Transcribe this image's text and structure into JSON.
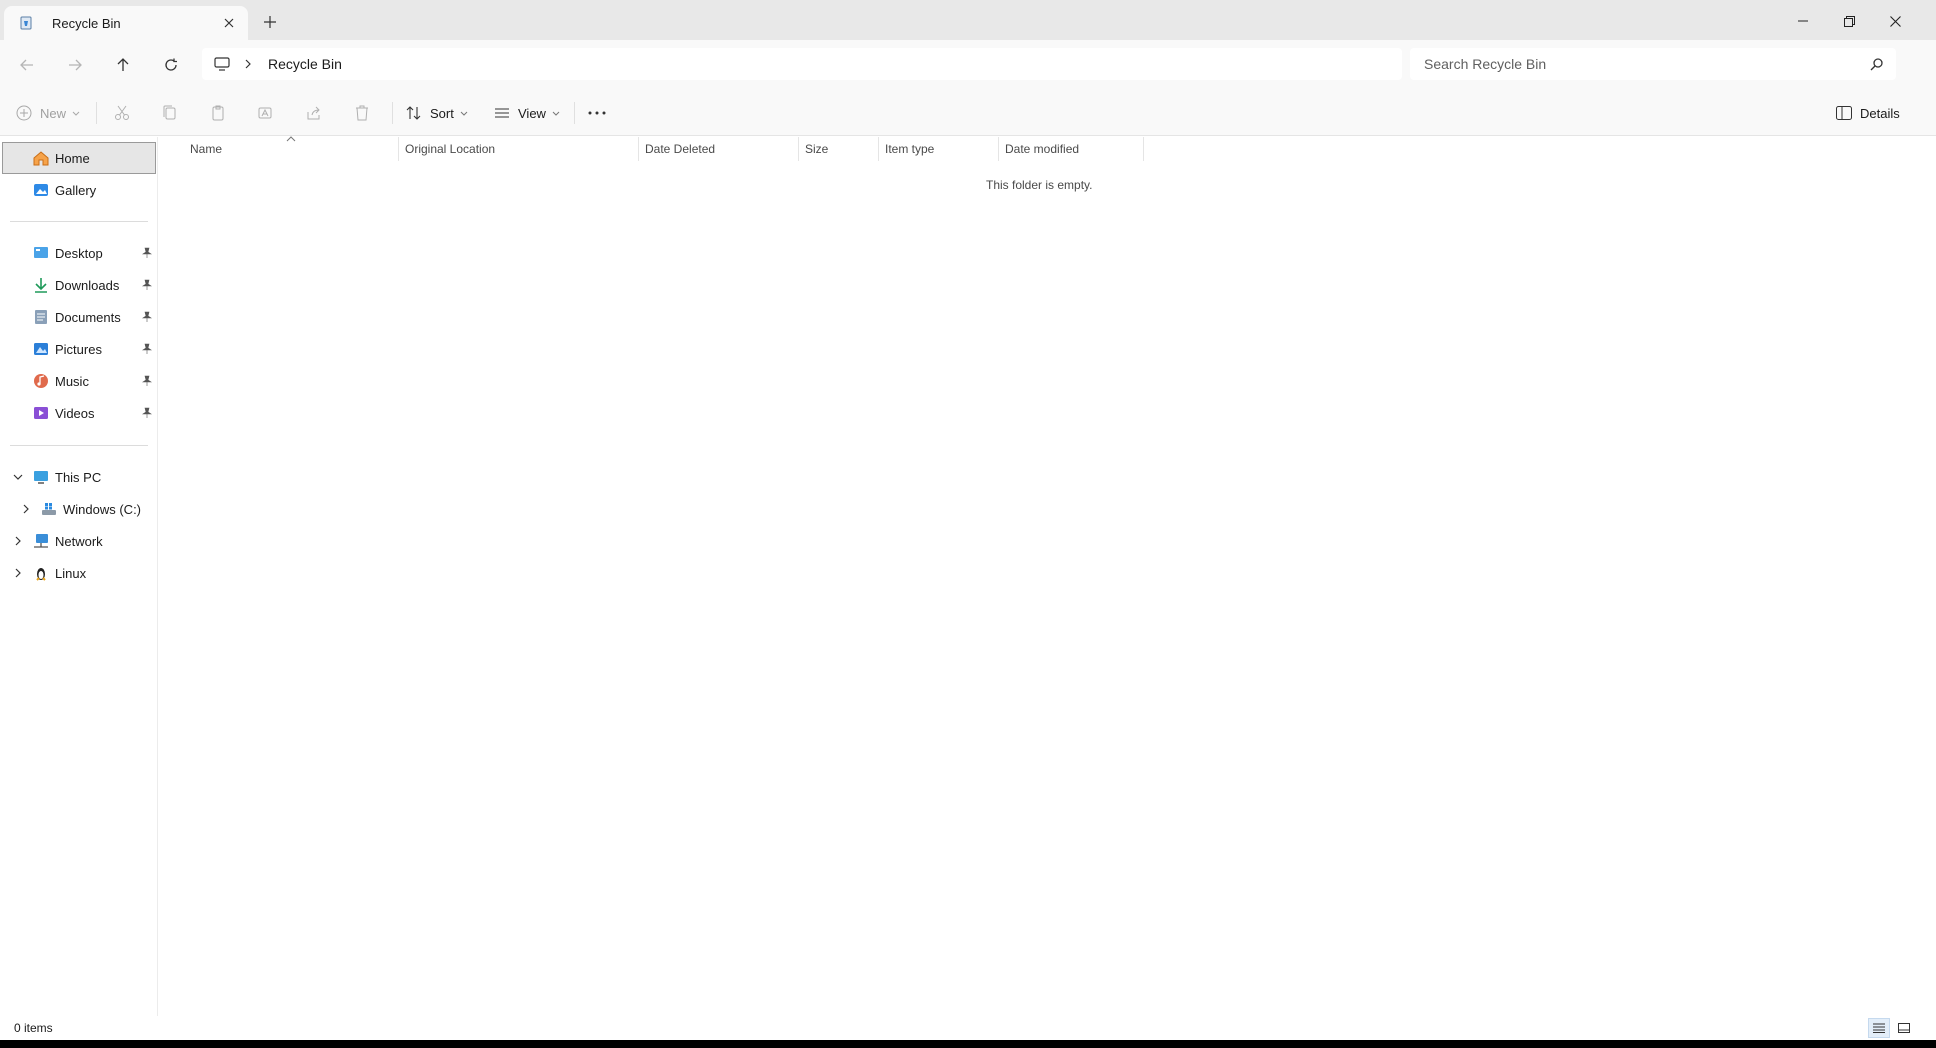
{
  "tab": {
    "title": "Recycle Bin"
  },
  "address": {
    "crumb": "Recycle Bin"
  },
  "search": {
    "placeholder": "Search Recycle Bin"
  },
  "commandbar": {
    "new_label": "New",
    "sort_label": "Sort",
    "view_label": "View",
    "details_label": "Details"
  },
  "sidebar": {
    "home": "Home",
    "gallery": "Gallery",
    "desktop": "Desktop",
    "downloads": "Downloads",
    "documents": "Documents",
    "pictures": "Pictures",
    "music": "Music",
    "videos": "Videos",
    "this_pc": "This PC",
    "windows_c": "Windows (C:)",
    "network": "Network",
    "linux": "Linux"
  },
  "columns": [
    "Name",
    "Original Location",
    "Date Deleted",
    "Size",
    "Item type",
    "Date modified"
  ],
  "main": {
    "empty_message": "This folder is empty."
  },
  "status": {
    "item_count": "0 items"
  },
  "colors": {
    "accent": "#0067c0",
    "selected_bg": "#e6e6e6",
    "chrome": "#e8e8e8"
  }
}
